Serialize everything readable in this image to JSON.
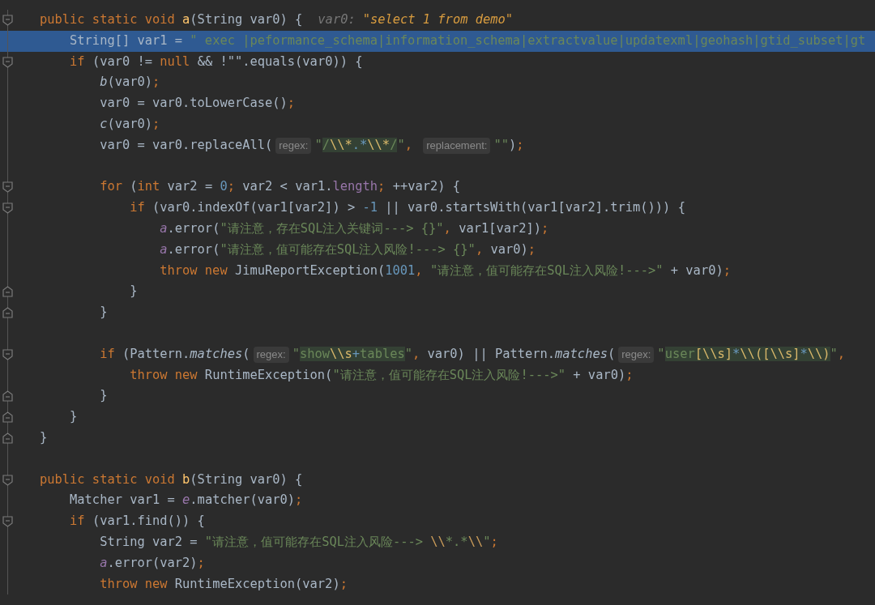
{
  "editor": {
    "lines": [
      {
        "kind": "fold_start",
        "selected": false,
        "tokens": [
          {
            "kind": "kw",
            "text": "public static void "
          },
          {
            "kind": "decl",
            "text": "a"
          },
          {
            "kind": "id",
            "text": "(String var0) {"
          },
          {
            "kind": "dbg_name",
            "text": "var0:"
          },
          {
            "kind": "dbg_val",
            "text": "\"select 1 from demo\""
          }
        ]
      },
      {
        "kind": "code",
        "selected": true,
        "tokens": [
          {
            "kind": "id",
            "text": "    String[] var1 = "
          },
          {
            "kind": "str",
            "text": "\" exec |peformance_schema|information_schema|extractvalue|updatexml|geohash|gtid_subset|gt"
          }
        ]
      },
      {
        "kind": "fold_start",
        "selected": false,
        "tokens": [
          {
            "kind": "kw",
            "text": "    if "
          },
          {
            "kind": "id",
            "text": "(var0 != "
          },
          {
            "kind": "kw",
            "text": "null"
          },
          {
            "kind": "id",
            "text": " && !\"\".equals(var0)) {"
          }
        ]
      },
      {
        "kind": "code",
        "selected": false,
        "tokens": [
          {
            "kind": "call",
            "text": "        b"
          },
          {
            "kind": "id",
            "text": "(var0)"
          },
          {
            "kind": "punc",
            "text": ";"
          }
        ]
      },
      {
        "kind": "code",
        "selected": false,
        "tokens": [
          {
            "kind": "id",
            "text": "        var0 = var0.toLowerCase()"
          },
          {
            "kind": "punc",
            "text": ";"
          }
        ]
      },
      {
        "kind": "code",
        "selected": false,
        "tokens": [
          {
            "kind": "call",
            "text": "        c"
          },
          {
            "kind": "id",
            "text": "(var0)"
          },
          {
            "kind": "punc",
            "text": ";"
          }
        ]
      },
      {
        "kind": "code",
        "selected": false,
        "tokens": [
          {
            "kind": "id",
            "text": "        var0 = var0.replaceAll("
          },
          {
            "kind": "hint",
            "text": "regex:"
          },
          {
            "kind": "str",
            "text": "\""
          },
          {
            "kind": "rx",
            "text": "/"
          },
          {
            "kind": "rxesc",
            "text": "\\\\*"
          },
          {
            "kind": "rxop",
            "text": ".*"
          },
          {
            "kind": "rxesc",
            "text": "\\\\*"
          },
          {
            "kind": "rx",
            "text": "/"
          },
          {
            "kind": "str",
            "text": "\""
          },
          {
            "kind": "punc",
            "text": ", "
          },
          {
            "kind": "hint",
            "text": "replacement:"
          },
          {
            "kind": "str",
            "text": "\"\""
          },
          {
            "kind": "id",
            "text": ")"
          },
          {
            "kind": "punc",
            "text": ";"
          }
        ]
      },
      {
        "kind": "blank",
        "selected": false
      },
      {
        "kind": "fold_start",
        "selected": false,
        "tokens": [
          {
            "kind": "kw",
            "text": "        for "
          },
          {
            "kind": "id",
            "text": "("
          },
          {
            "kind": "kw",
            "text": "int "
          },
          {
            "kind": "id",
            "text": "var2 = "
          },
          {
            "kind": "num",
            "text": "0"
          },
          {
            "kind": "punc",
            "text": "; "
          },
          {
            "kind": "id",
            "text": "var2 < var1."
          },
          {
            "kind": "prop",
            "text": "length"
          },
          {
            "kind": "punc",
            "text": "; "
          },
          {
            "kind": "id",
            "text": "++var2) {"
          }
        ]
      },
      {
        "kind": "fold_start",
        "selected": false,
        "tokens": [
          {
            "kind": "kw",
            "text": "            if "
          },
          {
            "kind": "id",
            "text": "(var0.indexOf(var1[var2]) > "
          },
          {
            "kind": "num",
            "text": "-1"
          },
          {
            "kind": "id",
            "text": " || var0.startsWith(var1[var2].trim())) {"
          }
        ]
      },
      {
        "kind": "code",
        "selected": false,
        "tokens": [
          {
            "kind": "field",
            "text": "                a"
          },
          {
            "kind": "id",
            "text": ".error("
          },
          {
            "kind": "str",
            "text": "\"请注意，存在SQL注入关键词---> {}\""
          },
          {
            "kind": "punc",
            "text": ", "
          },
          {
            "kind": "id",
            "text": "var1[var2])"
          },
          {
            "kind": "punc",
            "text": ";"
          }
        ]
      },
      {
        "kind": "code",
        "selected": false,
        "tokens": [
          {
            "kind": "field",
            "text": "                a"
          },
          {
            "kind": "id",
            "text": ".error("
          },
          {
            "kind": "str",
            "text": "\"请注意，值可能存在SQL注入风险!---> {}\""
          },
          {
            "kind": "punc",
            "text": ", "
          },
          {
            "kind": "id",
            "text": "var0)"
          },
          {
            "kind": "punc",
            "text": ";"
          }
        ]
      },
      {
        "kind": "code",
        "selected": false,
        "tokens": [
          {
            "kind": "kw",
            "text": "                throw new "
          },
          {
            "kind": "id",
            "text": "JimuReportException("
          },
          {
            "kind": "num",
            "text": "1001"
          },
          {
            "kind": "punc",
            "text": ", "
          },
          {
            "kind": "str",
            "text": "\"请注意，值可能存在SQL注入风险!--->\""
          },
          {
            "kind": "id",
            "text": " + var0)"
          },
          {
            "kind": "punc",
            "text": ";"
          }
        ]
      },
      {
        "kind": "fold_end",
        "selected": false,
        "tokens": [
          {
            "kind": "id",
            "text": "            }"
          }
        ]
      },
      {
        "kind": "fold_end",
        "selected": false,
        "tokens": [
          {
            "kind": "id",
            "text": "        }"
          }
        ]
      },
      {
        "kind": "blank",
        "selected": false
      },
      {
        "kind": "fold_start",
        "selected": false,
        "tokens": [
          {
            "kind": "kw",
            "text": "        if "
          },
          {
            "kind": "id",
            "text": "(Pattern."
          },
          {
            "kind": "call",
            "text": "matches"
          },
          {
            "kind": "id",
            "text": "("
          },
          {
            "kind": "hint",
            "text": "regex:"
          },
          {
            "kind": "str",
            "text": "\""
          },
          {
            "kind": "rx",
            "text": "show"
          },
          {
            "kind": "rxesc",
            "text": "\\\\s"
          },
          {
            "kind": "rxop",
            "text": "+"
          },
          {
            "kind": "rx",
            "text": "tables"
          },
          {
            "kind": "str",
            "text": "\""
          },
          {
            "kind": "punc",
            "text": ", "
          },
          {
            "kind": "id",
            "text": "var0) || Pattern."
          },
          {
            "kind": "call",
            "text": "matches"
          },
          {
            "kind": "id",
            "text": "("
          },
          {
            "kind": "hint",
            "text": "regex:"
          },
          {
            "kind": "str",
            "text": "\""
          },
          {
            "kind": "rx",
            "text": "user"
          },
          {
            "kind": "rxesc",
            "text": "[\\\\s]"
          },
          {
            "kind": "rxop",
            "text": "*"
          },
          {
            "kind": "rxesc",
            "text": "\\\\([\\\\s]"
          },
          {
            "kind": "rxop",
            "text": "*"
          },
          {
            "kind": "rxesc",
            "text": "\\\\)"
          },
          {
            "kind": "str",
            "text": "\""
          },
          {
            "kind": "punc",
            "text": ","
          }
        ]
      },
      {
        "kind": "code",
        "selected": false,
        "tokens": [
          {
            "kind": "kw",
            "text": "            throw new "
          },
          {
            "kind": "id",
            "text": "RuntimeException("
          },
          {
            "kind": "str",
            "text": "\"请注意，值可能存在SQL注入风险!--->\""
          },
          {
            "kind": "id",
            "text": " + var0)"
          },
          {
            "kind": "punc",
            "text": ";"
          }
        ]
      },
      {
        "kind": "fold_end",
        "selected": false,
        "tokens": [
          {
            "kind": "id",
            "text": "        }"
          }
        ]
      },
      {
        "kind": "fold_end",
        "selected": false,
        "tokens": [
          {
            "kind": "id",
            "text": "    }"
          }
        ]
      },
      {
        "kind": "fold_end",
        "selected": false,
        "tokens": [
          {
            "kind": "id",
            "text": "}"
          }
        ]
      },
      {
        "kind": "blank",
        "selected": false
      },
      {
        "kind": "fold_start",
        "selected": false,
        "tokens": [
          {
            "kind": "kw",
            "text": "public static void "
          },
          {
            "kind": "decl",
            "text": "b"
          },
          {
            "kind": "id",
            "text": "(String var0) {"
          }
        ]
      },
      {
        "kind": "code",
        "selected": false,
        "tokens": [
          {
            "kind": "id",
            "text": "    Matcher var1 = "
          },
          {
            "kind": "field",
            "text": "e"
          },
          {
            "kind": "id",
            "text": ".matcher(var0)"
          },
          {
            "kind": "punc",
            "text": ";"
          }
        ]
      },
      {
        "kind": "fold_start",
        "selected": false,
        "tokens": [
          {
            "kind": "kw",
            "text": "    if "
          },
          {
            "kind": "id",
            "text": "(var1.find()) {"
          }
        ]
      },
      {
        "kind": "code",
        "selected": false,
        "tokens": [
          {
            "kind": "id",
            "text": "        String var2 = "
          },
          {
            "kind": "str",
            "text": "\"请注意，值可能存在SQL注入风险---> "
          },
          {
            "kind": "esc",
            "text": "\\\\"
          },
          {
            "kind": "str",
            "text": "*.*"
          },
          {
            "kind": "esc",
            "text": "\\\\"
          },
          {
            "kind": "str",
            "text": "\""
          },
          {
            "kind": "punc",
            "text": ";"
          }
        ]
      },
      {
        "kind": "code",
        "selected": false,
        "tokens": [
          {
            "kind": "field",
            "text": "        a"
          },
          {
            "kind": "id",
            "text": ".error(var2)"
          },
          {
            "kind": "punc",
            "text": ";"
          }
        ]
      },
      {
        "kind": "code",
        "selected": false,
        "tokens": [
          {
            "kind": "kw",
            "text": "        throw new "
          },
          {
            "kind": "id",
            "text": "RuntimeException(var2)"
          },
          {
            "kind": "punc",
            "text": ";"
          }
        ]
      }
    ]
  }
}
